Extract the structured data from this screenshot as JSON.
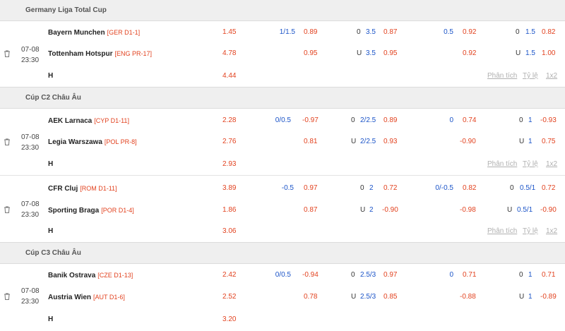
{
  "leagues": [
    {
      "name": "Germany Liga Total Cup",
      "matches": [
        {
          "date": "07-08",
          "time": "23:30",
          "home": {
            "name": "Bayern Munchen",
            "rank": "[GER D1-1]",
            "odds": "1.45",
            "ah_line": "1/1.5",
            "ah_odds": "0.89",
            "ou_label": "0",
            "ou_line": "3.5",
            "ou_odds": "0.87",
            "ah1_line": "0.5",
            "ah1_odds": "0.92",
            "ou1_label": "0",
            "ou1_line": "1.5",
            "ou1_odds": "0.82"
          },
          "away": {
            "name": "Tottenham Hotspur",
            "rank": "[ENG PR-17]",
            "odds": "4.78",
            "ah_line": "",
            "ah_odds": "0.95",
            "ou_label": "U",
            "ou_line": "3.5",
            "ou_odds": "0.95",
            "ah1_line": "",
            "ah1_odds": "0.92",
            "ou1_label": "U",
            "ou1_line": "1.5",
            "ou1_odds": "1.00"
          },
          "draw": {
            "label": "H",
            "odds": "4.44"
          },
          "links": [
            "Phân tích",
            "Tỷ lệ",
            "1x2"
          ]
        }
      ]
    },
    {
      "name": "Cúp C2 Châu Âu",
      "matches": [
        {
          "date": "07-08",
          "time": "23:30",
          "home": {
            "name": "AEK Larnaca",
            "rank": "[CYP D1-11]",
            "odds": "2.28",
            "ah_line": "0/0.5",
            "ah_odds": "-0.97",
            "ou_label": "0",
            "ou_line": "2/2.5",
            "ou_odds": "0.89",
            "ah1_line": "0",
            "ah1_odds": "0.74",
            "ou1_label": "0",
            "ou1_line": "1",
            "ou1_odds": "-0.93"
          },
          "away": {
            "name": "Legia Warszawa",
            "rank": "[POL PR-8]",
            "odds": "2.76",
            "ah_line": "",
            "ah_odds": "0.81",
            "ou_label": "U",
            "ou_line": "2/2.5",
            "ou_odds": "0.93",
            "ah1_line": "",
            "ah1_odds": "-0.90",
            "ou1_label": "U",
            "ou1_line": "1",
            "ou1_odds": "0.75"
          },
          "draw": {
            "label": "H",
            "odds": "2.93"
          },
          "links": [
            "Phân tích",
            "Tỷ lệ",
            "1x2"
          ]
        },
        {
          "date": "07-08",
          "time": "23:30",
          "home": {
            "name": "CFR Cluj",
            "rank": "[ROM D1-11]",
            "odds": "3.89",
            "ah_line": "-0.5",
            "ah_odds": "0.97",
            "ou_label": "0",
            "ou_line": "2",
            "ou_odds": "0.72",
            "ah1_line": "0/-0.5",
            "ah1_odds": "0.82",
            "ou1_label": "0",
            "ou1_line": "0.5/1",
            "ou1_odds": "0.72"
          },
          "away": {
            "name": "Sporting Braga",
            "rank": "[POR D1-4]",
            "odds": "1.86",
            "ah_line": "",
            "ah_odds": "0.87",
            "ou_label": "U",
            "ou_line": "2",
            "ou_odds": "-0.90",
            "ah1_line": "",
            "ah1_odds": "-0.98",
            "ou1_label": "U",
            "ou1_line": "0.5/1",
            "ou1_odds": "-0.90"
          },
          "draw": {
            "label": "H",
            "odds": "3.06"
          },
          "links": [
            "Phân tích",
            "Tỷ lệ",
            "1x2"
          ]
        }
      ]
    },
    {
      "name": "Cúp C3 Châu Âu",
      "matches": [
        {
          "date": "07-08",
          "time": "23:30",
          "home": {
            "name": "Banik Ostrava",
            "rank": "[CZE D1-13]",
            "odds": "2.42",
            "ah_line": "0/0.5",
            "ah_odds": "-0.94",
            "ou_label": "0",
            "ou_line": "2.5/3",
            "ou_odds": "0.97",
            "ah1_line": "0",
            "ah1_odds": "0.71",
            "ou1_label": "0",
            "ou1_line": "1",
            "ou1_odds": "0.71"
          },
          "away": {
            "name": "Austria Wien",
            "rank": "[AUT D1-6]",
            "odds": "2.52",
            "ah_line": "",
            "ah_odds": "0.78",
            "ou_label": "U",
            "ou_line": "2.5/3",
            "ou_odds": "0.85",
            "ah1_line": "",
            "ah1_odds": "-0.88",
            "ou1_label": "U",
            "ou1_line": "1",
            "ou1_odds": "-0.89"
          },
          "draw": {
            "label": "H",
            "odds": "3.20"
          },
          "links": [
            null,
            null,
            null
          ]
        }
      ]
    }
  ],
  "colors": {
    "odds": "#e2421f",
    "line": "#1b54c8",
    "rank": "#e2421f",
    "header_bg": "#efefef",
    "link": "#b0b0b0"
  },
  "icons": {
    "delete": "trash-icon"
  }
}
